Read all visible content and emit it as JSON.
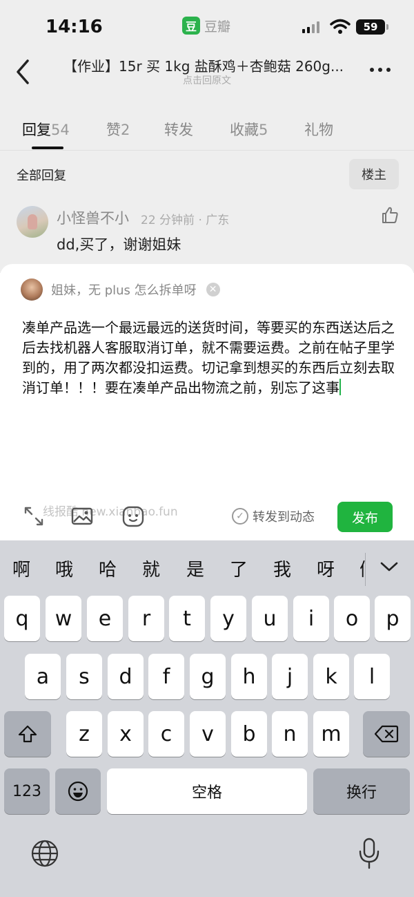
{
  "status_bar": {
    "time": "14:16",
    "app_name": "豆瓣",
    "app_logo": "豆",
    "battery": "59"
  },
  "nav": {
    "title": "【作业】15r 买 1kg 盐酥鸡＋杏鲍菇 260g...",
    "subtitle": "点击回原文"
  },
  "tabs": [
    {
      "label": "回复",
      "count": "54"
    },
    {
      "label": "赞",
      "count": "2"
    },
    {
      "label": "转发",
      "count": ""
    },
    {
      "label": "收藏",
      "count": "5"
    },
    {
      "label": "礼物",
      "count": ""
    }
  ],
  "section": {
    "title": "全部回复",
    "op_button": "楼主"
  },
  "comment": {
    "user": "小怪兽不小",
    "meta": "22 分钟前 · 广东",
    "text": "dd,买了，谢谢姐妹"
  },
  "composer": {
    "reply_to": "姐妹，无 plus 怎么拆单呀",
    "draft": "凑单产品选一个最远最远的送货时间，等要买的东西送达后之后去找机器人客服取消订单，就不需要运费。之前在帖子里学到的，用了两次都没扣运费。切记拿到想买的东西后立刻去取消订单！！！要在凑单产品出物流之前，别忘了这事",
    "watermark": "线报酷 new.xianbao.fun",
    "repost_label": "转发到动态",
    "publish": "发布"
  },
  "keyboard": {
    "candidates": [
      "啊",
      "哦",
      "哈",
      "就",
      "是",
      "了",
      "我",
      "呀",
      "们"
    ],
    "row1": [
      "q",
      "w",
      "e",
      "r",
      "t",
      "y",
      "u",
      "i",
      "o",
      "p"
    ],
    "row2": [
      "a",
      "s",
      "d",
      "f",
      "g",
      "h",
      "j",
      "k",
      "l"
    ],
    "row3": [
      "z",
      "x",
      "c",
      "v",
      "b",
      "n",
      "m"
    ],
    "num_key": "123",
    "space": "空格",
    "return": "换行"
  },
  "colors": {
    "accent": "#20b43f",
    "keyboard_bg": "#d3d5da"
  },
  "icons": [
    "back-icon",
    "more-icon",
    "like-icon",
    "clear-icon",
    "expand-icon",
    "image-icon",
    "emoji-icon",
    "check-icon",
    "collapse-icon",
    "shift-icon",
    "delete-icon",
    "emoji-key-icon",
    "globe-icon",
    "mic-icon"
  ]
}
